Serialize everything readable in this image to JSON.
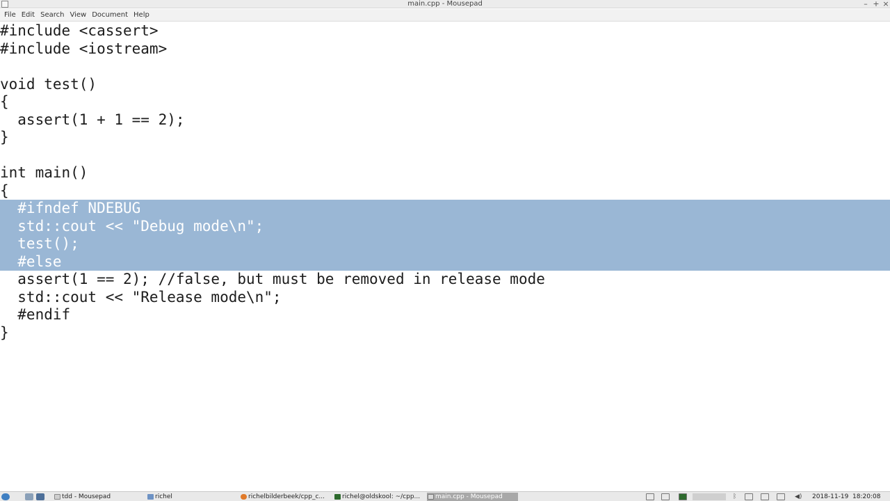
{
  "window": {
    "title": "main.cpp - Mousepad",
    "controls": [
      "–",
      "+",
      "×"
    ]
  },
  "menu": [
    "File",
    "Edit",
    "Search",
    "View",
    "Document",
    "Help"
  ],
  "editor": {
    "lines": [
      "#include <cassert>",
      "#include <iostream>",
      "",
      "void test()",
      "{",
      "  assert(1 + 1 == 2);",
      "}",
      "",
      "int main()",
      "{",
      "  #ifndef NDEBUG",
      "  std::cout << \"Debug mode\\n\";",
      "  test();",
      "  #else",
      "  assert(1 == 2); //false, but must be removed in release mode",
      "  std::cout << \"Release mode\\n\";",
      "  #endif",
      "}"
    ],
    "selected_lines": [
      10,
      11,
      12,
      13
    ],
    "selection_color": "#9ab7d5"
  },
  "taskbar": {
    "tasks": [
      {
        "label": "tdd - Mousepad",
        "icon": "file-icon",
        "active": false
      },
      {
        "label": "richel",
        "icon": "folder-icon",
        "active": false
      },
      {
        "label": "richelbilderbeek/cpp_c...",
        "icon": "firefox-icon",
        "active": false
      },
      {
        "label": "richel@oldskool: ~/cpp...",
        "icon": "terminal-icon",
        "active": false
      },
      {
        "label": "main.cpp - Mousepad",
        "icon": "file-icon",
        "active": true
      }
    ],
    "date": "2018-11-19",
    "time": "18:20:08"
  }
}
